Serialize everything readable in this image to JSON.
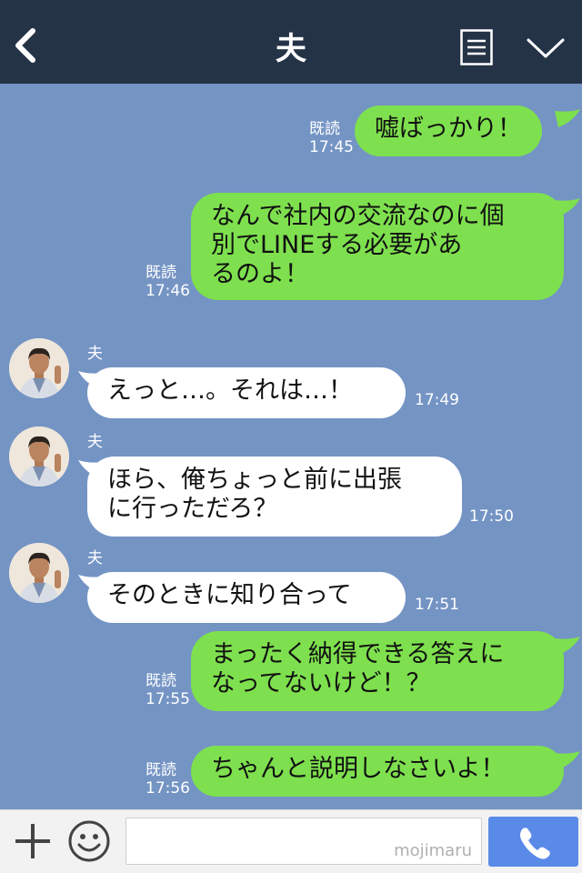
{
  "header": {
    "title": "夫",
    "back_icon": "chevron-left-icon",
    "menu_icon": "notes-icon",
    "collapse_icon": "chevron-down-icon",
    "background": "#253347"
  },
  "chat": {
    "background": "#7494c4",
    "sent_bubble_color": "#7ee04e",
    "received_bubble_color": "#ffffff",
    "messages": [
      {
        "direction": "sent",
        "text": "嘘ばっかり！",
        "read": "既読",
        "time": "17:45"
      },
      {
        "direction": "sent",
        "text": "なんで社内の交流なのに個\n別でLINEする必要があ\nるのよ！",
        "read": "既読",
        "time": "17:46"
      },
      {
        "direction": "received",
        "sender": "夫",
        "text": "えっと…。それは…！",
        "time": "17:49"
      },
      {
        "direction": "received",
        "sender": "夫",
        "text": "ほら、俺ちょっと前に出張\nに行っただろ？",
        "time": "17:50"
      },
      {
        "direction": "received",
        "sender": "夫",
        "text": "そのときに知り合って",
        "time": "17:51"
      },
      {
        "direction": "sent",
        "text": "まったく納得できる答えに\nなってないけど！？",
        "read": "既読",
        "time": "17:55"
      },
      {
        "direction": "sent",
        "text": "ちゃんと説明しなさいよ！",
        "read": "既読",
        "time": "17:56"
      }
    ]
  },
  "footer": {
    "plus_icon": "plus-icon",
    "emoji_icon": "smiley-icon",
    "input_value": "",
    "watermark": "mojimaru",
    "call_icon": "phone-icon",
    "call_color": "#5a8ae8"
  }
}
